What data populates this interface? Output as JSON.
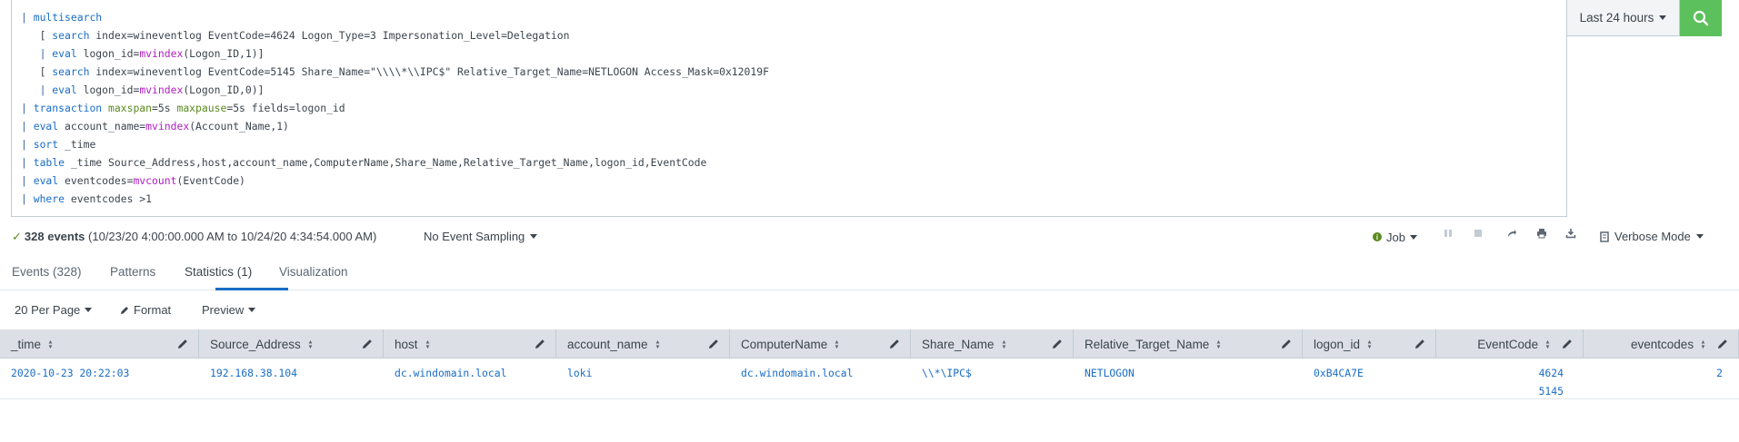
{
  "search": {
    "lines": [
      {
        "indent": "",
        "tokens": [
          [
            "pipe",
            "| "
          ],
          [
            "cmd",
            "multisearch"
          ]
        ]
      },
      {
        "indent": "   ",
        "tokens": [
          [
            "txt",
            "[ "
          ],
          [
            "cmd",
            "search"
          ],
          [
            "txt",
            " index=wineventlog EventCode=4624 Logon_Type=3 Impersonation_Level=Delegation"
          ]
        ]
      },
      {
        "indent": "   ",
        "tokens": [
          [
            "pipe",
            "| "
          ],
          [
            "cmd",
            "eval"
          ],
          [
            "txt",
            " logon_id="
          ],
          [
            "fn",
            "mvindex"
          ],
          [
            "txt",
            "(Logon_ID,1)]"
          ]
        ]
      },
      {
        "indent": "   ",
        "tokens": [
          [
            "txt",
            "[ "
          ],
          [
            "cmd",
            "search"
          ],
          [
            "txt",
            " index=wineventlog EventCode=5145 Share_Name=\"\\\\\\\\*\\\\IPC$\" Relative_Target_Name=NETLOGON Access_Mask=0x12019F"
          ]
        ]
      },
      {
        "indent": "   ",
        "tokens": [
          [
            "pipe",
            "| "
          ],
          [
            "cmd",
            "eval"
          ],
          [
            "txt",
            " logon_id="
          ],
          [
            "fn",
            "mvindex"
          ],
          [
            "txt",
            "(Logon_ID,0)]"
          ]
        ]
      },
      {
        "indent": "",
        "tokens": [
          [
            "pipe",
            "| "
          ],
          [
            "cmd",
            "transaction"
          ],
          [
            "txt",
            " "
          ],
          [
            "kw",
            "maxspan"
          ],
          [
            "txt",
            "=5s "
          ],
          [
            "kw",
            "maxpause"
          ],
          [
            "txt",
            "=5s fields=logon_id"
          ]
        ]
      },
      {
        "indent": "",
        "tokens": [
          [
            "pipe",
            "| "
          ],
          [
            "cmd",
            "eval"
          ],
          [
            "txt",
            " account_name="
          ],
          [
            "fn",
            "mvindex"
          ],
          [
            "txt",
            "(Account_Name,1)"
          ]
        ]
      },
      {
        "indent": "",
        "tokens": [
          [
            "pipe",
            "| "
          ],
          [
            "cmd",
            "sort"
          ],
          [
            "txt",
            " _time"
          ]
        ]
      },
      {
        "indent": "",
        "tokens": [
          [
            "pipe",
            "| "
          ],
          [
            "cmd",
            "table"
          ],
          [
            "txt",
            " _time Source_Address,host,account_name,ComputerName,Share_Name,Relative_Target_Name,logon_id,EventCode"
          ]
        ]
      },
      {
        "indent": "",
        "tokens": [
          [
            "pipe",
            "| "
          ],
          [
            "cmd",
            "eval"
          ],
          [
            "txt",
            " eventcodes="
          ],
          [
            "fn",
            "mvcount"
          ],
          [
            "txt",
            "(EventCode)"
          ]
        ]
      },
      {
        "indent": "",
        "tokens": [
          [
            "pipe",
            "| "
          ],
          [
            "cmd",
            "where"
          ],
          [
            "txt",
            " eventcodes >1"
          ]
        ]
      }
    ]
  },
  "time_picker": {
    "label": "Last 24 hours"
  },
  "search_button": {
    "icon": "search-icon",
    "color": "#5cc05c"
  },
  "status": {
    "check": "✓",
    "event_count": "328 events",
    "range": "(10/23/20 4:00:00.000 AM to 10/24/20 4:34:54.000 AM)",
    "sampling": "No Event Sampling",
    "job": "Job",
    "mode": "Verbose Mode"
  },
  "tabs": [
    {
      "label": "Events (328)",
      "active": false
    },
    {
      "label": "Patterns",
      "active": false
    },
    {
      "label": "Statistics (1)",
      "active": true
    },
    {
      "label": "Visualization",
      "active": false
    }
  ],
  "table_toolbar": {
    "per_page": "20 Per Page",
    "format": "Format",
    "preview": "Preview"
  },
  "table": {
    "columns": [
      "_time",
      "Source_Address",
      "host",
      "account_name",
      "ComputerName",
      "Share_Name",
      "Relative_Target_Name",
      "logon_id",
      "EventCode",
      "eventcodes"
    ],
    "rows": [
      {
        "_time": "2020-10-23 20:22:03",
        "Source_Address": "192.168.38.104",
        "host": "dc.windomain.local",
        "account_name": "loki",
        "ComputerName": "dc.windomain.local",
        "Share_Name": "\\\\*\\IPC$",
        "Relative_Target_Name": "NETLOGON",
        "logon_id": "0xB4CA7E",
        "EventCode": [
          "4624",
          "5145"
        ],
        "eventcodes": "2"
      }
    ]
  },
  "colors": {
    "accent": "#1a6dc7",
    "header_bg": "#dce0e6",
    "success": "#5cc05c"
  }
}
